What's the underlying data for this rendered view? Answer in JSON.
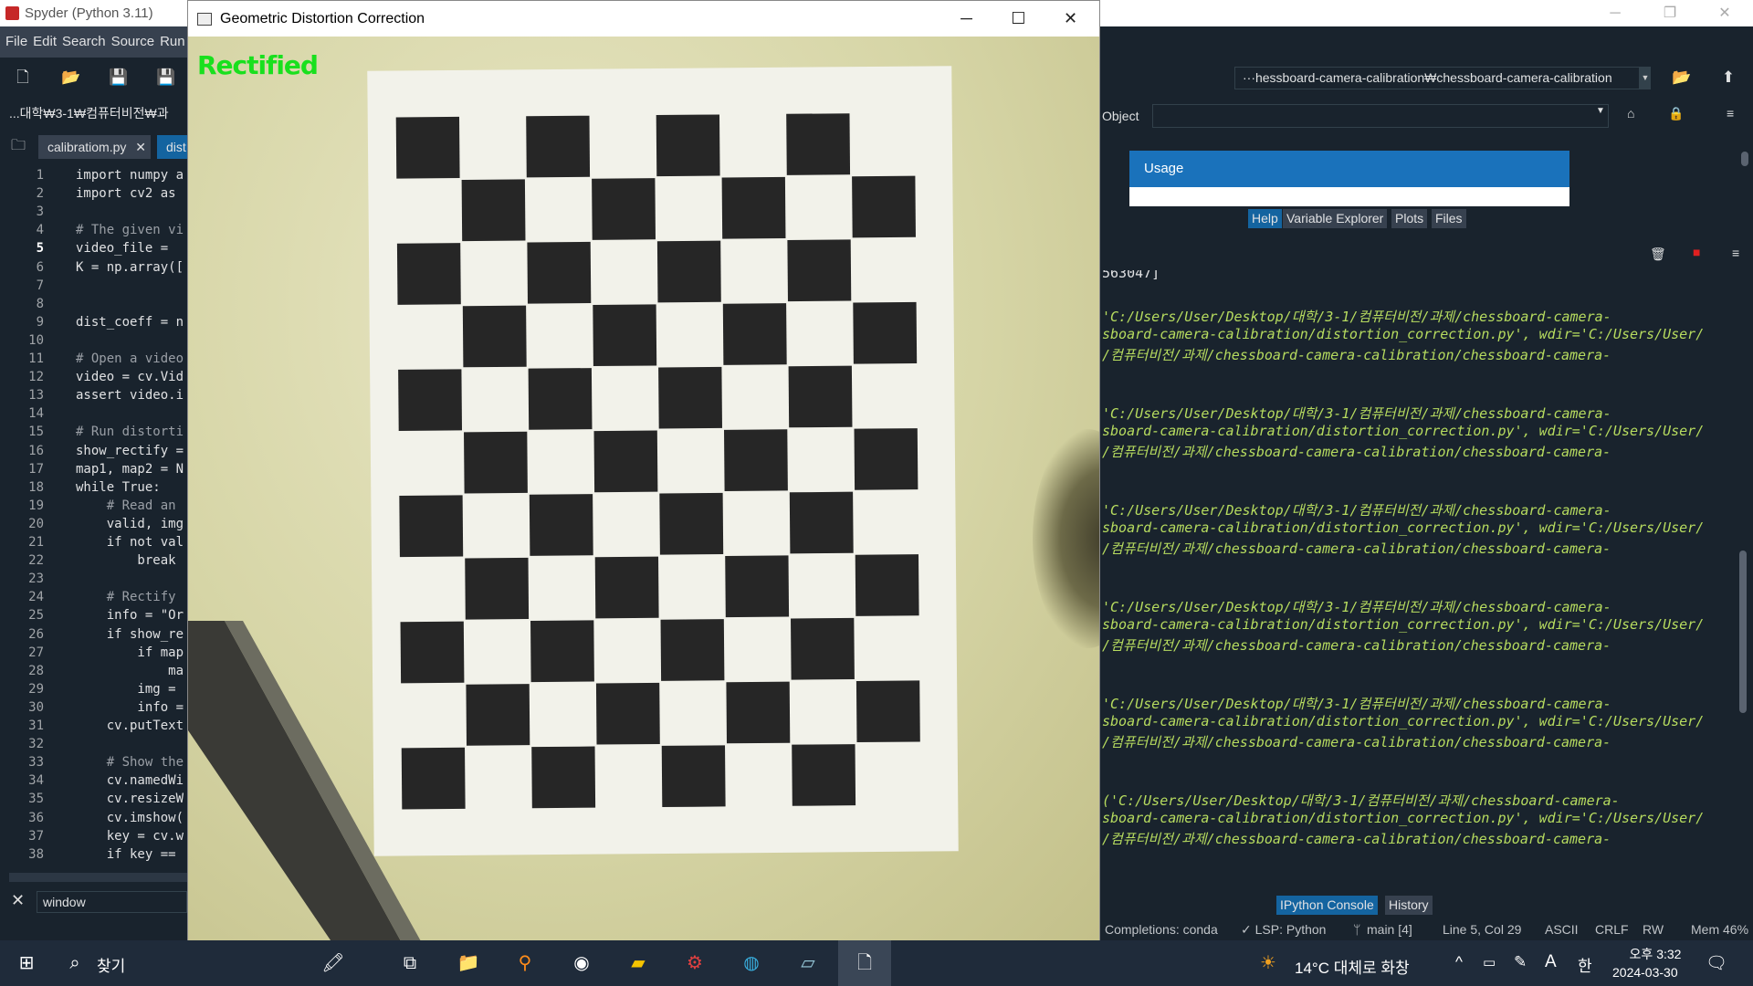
{
  "spyder": {
    "title": "Spyder (Python 3.11)",
    "menu": [
      "File",
      "Edit",
      "Search",
      "Source",
      "Run"
    ],
    "breadcrumb": "...대학₩3-1₩컴퓨터비전₩과",
    "path": "···hessboard-camera-calibration₩chessboard-camera-calibration",
    "tabs": [
      "calibratiom.py",
      "dist"
    ],
    "tab_close": "✕",
    "find_value": "window",
    "object_label": "Object",
    "usage_title": "Usage",
    "help_tabs": [
      "Help",
      "Variable Explorer",
      "Plots",
      "Files"
    ],
    "console_tabs": [
      "IPython Console",
      "History"
    ],
    "console_first": "563047]",
    "console_blocks": [
      [
        "'C:/Users/User/Desktop/대학/3-1/컴퓨터비전/과제/chessboard-camera-",
        "sboard-camera-calibration/distortion_correction.py', wdir='C:/Users/User/",
        "/컴퓨터비전/과제/chessboard-camera-calibration/chessboard-camera-"
      ],
      [
        "'C:/Users/User/Desktop/대학/3-1/컴퓨터비전/과제/chessboard-camera-",
        "sboard-camera-calibration/distortion_correction.py', wdir='C:/Users/User/",
        "/컴퓨터비전/과제/chessboard-camera-calibration/chessboard-camera-"
      ],
      [
        "'C:/Users/User/Desktop/대학/3-1/컴퓨터비전/과제/chessboard-camera-",
        "sboard-camera-calibration/distortion_correction.py', wdir='C:/Users/User/",
        "/컴퓨터비전/과제/chessboard-camera-calibration/chessboard-camera-"
      ],
      [
        "'C:/Users/User/Desktop/대학/3-1/컴퓨터비전/과제/chessboard-camera-",
        "sboard-camera-calibration/distortion_correction.py', wdir='C:/Users/User/",
        "/컴퓨터비전/과제/chessboard-camera-calibration/chessboard-camera-"
      ],
      [
        "'C:/Users/User/Desktop/대학/3-1/컴퓨터비전/과제/chessboard-camera-",
        "sboard-camera-calibration/distortion_correction.py', wdir='C:/Users/User/",
        "/컴퓨터비전/과제/chessboard-camera-calibration/chessboard-camera-"
      ],
      [
        "('C:/Users/User/Desktop/대학/3-1/컴퓨터비전/과제/chessboard-camera-",
        "sboard-camera-calibration/distortion_correction.py', wdir='C:/Users/User/",
        "/컴퓨터비전/과제/chessboard-camera-calibration/chessboard-camera-"
      ]
    ],
    "status": {
      "completions": "Completions: conda",
      "lsp": "✓ LSP: Python",
      "git": "main [4]",
      "position": "Line 5, Col 29",
      "encoding": "ASCII",
      "eol": "CRLF",
      "rw": "RW",
      "mem": "Mem 46%"
    },
    "code_lines": [
      {
        "n": "1",
        "t": "import numpy a",
        "c": false
      },
      {
        "n": "2",
        "t": "import cv2 as",
        "c": false
      },
      {
        "n": "3",
        "t": "",
        "c": false
      },
      {
        "n": "4",
        "t": "# The given vi",
        "c": true
      },
      {
        "n": "5",
        "t": "video_file =",
        "c": false
      },
      {
        "n": "6",
        "t": "K = np.array([",
        "c": false
      },
      {
        "n": "7",
        "t": "",
        "c": false
      },
      {
        "n": "8",
        "t": "",
        "c": false
      },
      {
        "n": "9",
        "t": "dist_coeff = n",
        "c": false
      },
      {
        "n": "10",
        "t": "",
        "c": false
      },
      {
        "n": "11",
        "t": "# Open a video",
        "c": true
      },
      {
        "n": "12",
        "t": "video = cv.Vid",
        "c": false
      },
      {
        "n": "13",
        "t": "assert video.i",
        "c": false
      },
      {
        "n": "14",
        "t": "",
        "c": false
      },
      {
        "n": "15",
        "t": "# Run distorti",
        "c": true
      },
      {
        "n": "16",
        "t": "show_rectify =",
        "c": false
      },
      {
        "n": "17",
        "t": "map1, map2 = N",
        "c": false
      },
      {
        "n": "18",
        "t": "while True:",
        "c": false
      },
      {
        "n": "19",
        "t": "    # Read an",
        "c": true
      },
      {
        "n": "20",
        "t": "    valid, img",
        "c": false
      },
      {
        "n": "21",
        "t": "    if not val",
        "c": false
      },
      {
        "n": "22",
        "t": "        break",
        "c": false
      },
      {
        "n": "23",
        "t": "",
        "c": false
      },
      {
        "n": "24",
        "t": "    # Rectify",
        "c": true
      },
      {
        "n": "25",
        "t": "    info = \"Or",
        "c": false
      },
      {
        "n": "26",
        "t": "    if show_re",
        "c": false
      },
      {
        "n": "27",
        "t": "        if map",
        "c": false
      },
      {
        "n": "28",
        "t": "            ma",
        "c": false
      },
      {
        "n": "29",
        "t": "        img =",
        "c": false
      },
      {
        "n": "30",
        "t": "        info =",
        "c": false
      },
      {
        "n": "31",
        "t": "    cv.putText",
        "c": false
      },
      {
        "n": "32",
        "t": "",
        "c": false
      },
      {
        "n": "33",
        "t": "    # Show the",
        "c": true
      },
      {
        "n": "34",
        "t": "    cv.namedWi",
        "c": false
      },
      {
        "n": "35",
        "t": "    cv.resizeW",
        "c": false
      },
      {
        "n": "36",
        "t": "    cv.imshow(",
        "c": false
      },
      {
        "n": "37",
        "t": "    key = cv.w",
        "c": false
      },
      {
        "n": "38",
        "t": "    if key ==",
        "c": false
      }
    ]
  },
  "cv_window": {
    "title": "Geometric Distortion Correction",
    "overlay_text": "Rectified",
    "overlay_color": "#19e01e"
  },
  "taskbar": {
    "search_label": "찾기",
    "weather": "14°C 대체로 화창",
    "time": "오후 3:32",
    "date": "2024-03-30",
    "ime": "A",
    "lang": "한"
  }
}
